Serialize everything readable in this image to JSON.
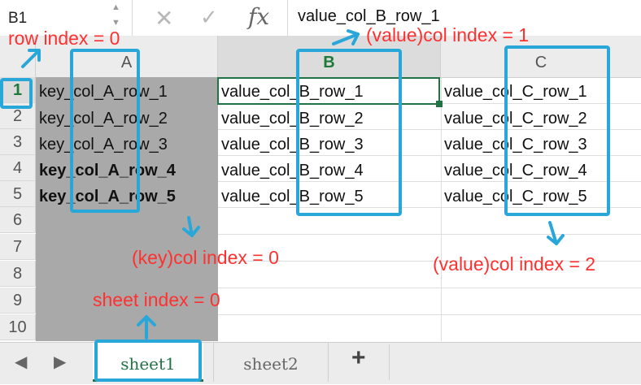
{
  "formula_bar": {
    "name_box": "B1",
    "fx_label": "fx",
    "cancel_glyph": "✕",
    "confirm_glyph": "✓",
    "value": "value_col_B_row_1"
  },
  "columns": [
    "A",
    "B",
    "C"
  ],
  "rows": [
    "1",
    "2",
    "3",
    "4",
    "5",
    "6",
    "7",
    "8",
    "9",
    "10"
  ],
  "col_a": [
    "key_col_A_row_1",
    "key_col_A_row_2",
    "key_col_A_row_3",
    "key_col_A_row_4",
    "key_col_A_row_5"
  ],
  "col_b": [
    "value_col_B_row_1",
    "value_col_B_row_2",
    "value_col_B_row_3",
    "value_col_B_row_4",
    "value_col_B_row_5"
  ],
  "col_c": [
    "value_col_C_row_1",
    "value_col_C_row_2",
    "value_col_C_row_3",
    "value_col_C_row_4",
    "value_col_C_row_5"
  ],
  "tabs": {
    "prev_glyph": "◀",
    "next_glyph": "▶",
    "sheet1": "sheet1",
    "sheet2": "sheet2",
    "add": "+"
  },
  "annotations": {
    "row_index": "row index = 0",
    "value_col_1": "(value)col index = 1",
    "key_col_0": "(key)col index = 0",
    "value_col_2": "(value)col index = 2",
    "sheet_index": "sheet index = 0"
  },
  "colors": {
    "annotation_text": "#ff3030",
    "annotation_box": "#2aa7d9",
    "excel_green": "#217346"
  }
}
